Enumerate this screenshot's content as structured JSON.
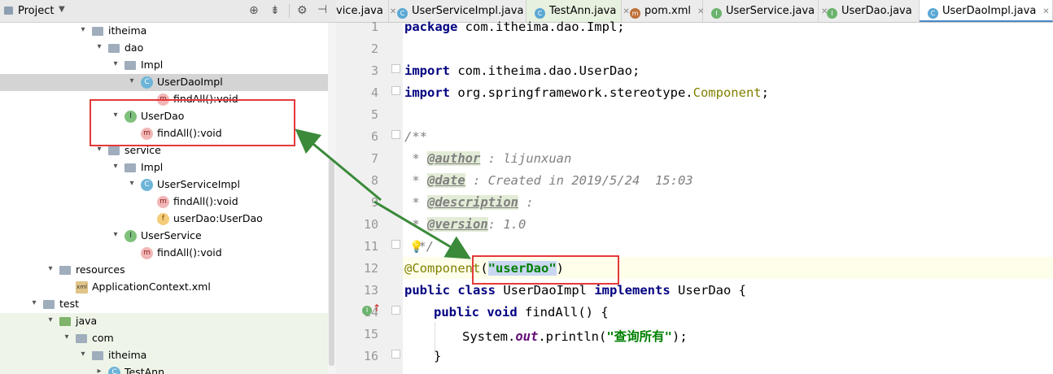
{
  "project_panel": {
    "title": "Project",
    "tree": [
      {
        "label": "itheima",
        "icon": "folder-icon"
      },
      {
        "label": "dao",
        "icon": "folder-icon"
      },
      {
        "label": "Impl",
        "icon": "folder-icon"
      },
      {
        "label": "UserDaoImpl",
        "icon": "class-icon",
        "badge": "C"
      },
      {
        "label": "findAll():void",
        "icon": "method-icon",
        "badge": "m"
      },
      {
        "label": "UserDao",
        "icon": "interface-icon",
        "badge": "I"
      },
      {
        "label": "findAll():void",
        "icon": "method-icon",
        "badge": "m"
      },
      {
        "label": "service",
        "icon": "folder-icon"
      },
      {
        "label": "Impl",
        "icon": "folder-icon"
      },
      {
        "label": "UserServiceImpl",
        "icon": "class-icon",
        "badge": "C"
      },
      {
        "label": "findAll():void",
        "icon": "method-icon",
        "badge": "m"
      },
      {
        "label": "userDao:UserDao",
        "icon": "field-icon",
        "badge": "f"
      },
      {
        "label": "UserService",
        "icon": "interface-icon",
        "badge": "I"
      },
      {
        "label": "findAll():void",
        "icon": "method-icon",
        "badge": "m"
      },
      {
        "label": "resources",
        "icon": "folder-icon"
      },
      {
        "label": "ApplicationContext.xml",
        "icon": "xml-icon",
        "badge": "xml"
      },
      {
        "label": "test",
        "icon": "folder-icon"
      },
      {
        "label": "java",
        "icon": "folder-icon"
      },
      {
        "label": "com",
        "icon": "folder-icon"
      },
      {
        "label": "itheima",
        "icon": "folder-icon"
      },
      {
        "label": "TestAnn",
        "icon": "class-icon",
        "badge": "C"
      }
    ]
  },
  "tabs": [
    {
      "label": "vice.java",
      "icon": "",
      "badge": ""
    },
    {
      "label": "UserServiceImpl.java",
      "icon": "class-icon",
      "badge": "C"
    },
    {
      "label": "TestAnn.java",
      "icon": "class-icon",
      "badge": "C"
    },
    {
      "label": "pom.xml",
      "icon": "maven-icon",
      "badge": "m"
    },
    {
      "label": "UserService.java",
      "icon": "interface-icon",
      "badge": "I"
    },
    {
      "label": "UserDao.java",
      "icon": "interface-icon",
      "badge": "I"
    },
    {
      "label": "UserDaoImpl.java",
      "icon": "class-icon",
      "badge": "C"
    }
  ],
  "editor": {
    "line_numbers": [
      "1",
      "2",
      "3",
      "4",
      "5",
      "6",
      "7",
      "8",
      "9",
      "10",
      "11",
      "12",
      "13",
      "14",
      "15",
      "16"
    ],
    "code": {
      "l1_kw": "package",
      "l1_rest": " com.itheima.dao.Impl;",
      "l3_kw": "import",
      "l3_rest": " com.itheima.dao.UserDao;",
      "l4_kw": "import",
      "l4_rest": " org.springframework.stereotype.",
      "l4_cls": "Component",
      "l4_end": ";",
      "l6": "/**",
      "l7_star": " * ",
      "l7_tag": "@author",
      "l7_rest": " : lijunxuan",
      "l8_star": " * ",
      "l8_tag": "@date",
      "l8_rest": " : Created in 2019/5/24  15:03",
      "l9_star": " * ",
      "l9_tag": "@description",
      "l9_rest": " :",
      "l10_star": " * ",
      "l10_tag": "@version",
      "l10_rest": ": 1.0",
      "l11": " */",
      "l12_ann": "@Component",
      "l12_open": "(",
      "l12_str": "\"userDao\"",
      "l12_close": ")",
      "l13_kw1": "public",
      "l13_kw2": "class",
      "l13_name": " UserDaoImpl ",
      "l13_kw3": "implements",
      "l13_rest": " UserDao {",
      "l14_kw1": "public",
      "l14_kw2": "void",
      "l14_rest": " findAll() {",
      "l15_a": "System.",
      "l15_out": "out",
      "l15_b": ".println(",
      "l15_str": "\"查询所有\"",
      "l15_c": ");",
      "l16": "}"
    }
  },
  "colors": {
    "annotation_box": "#e43a3a",
    "arrow": "#3a8a3a"
  }
}
